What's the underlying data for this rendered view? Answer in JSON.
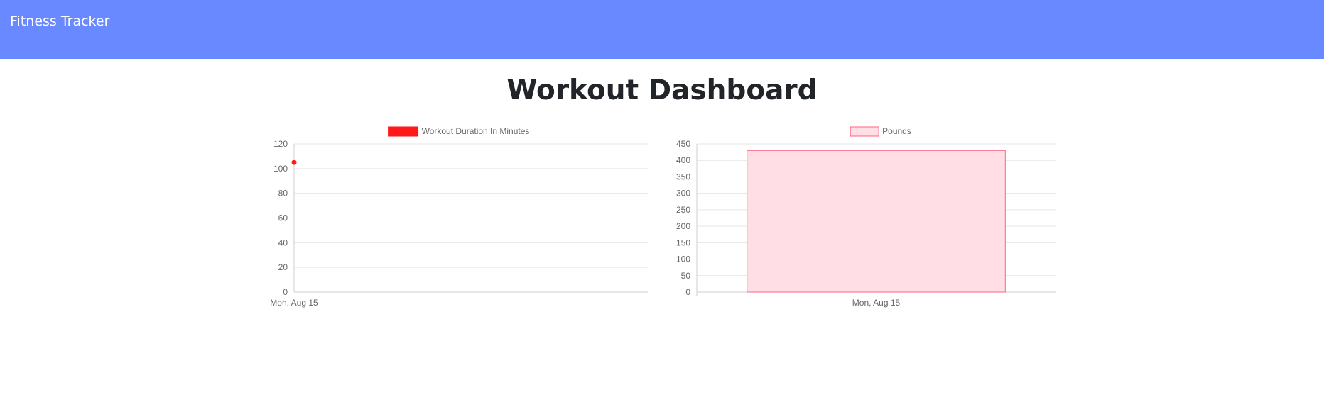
{
  "navbar": {
    "brand": "Fitness Tracker"
  },
  "page": {
    "title": "Workout Dashboard"
  },
  "chart_data": [
    {
      "type": "line",
      "legend": [
        "Workout Duration In Minutes"
      ],
      "legend_position": "top",
      "categories": [
        "Mon, Aug 15"
      ],
      "series": [
        {
          "name": "Workout Duration In Minutes",
          "values": [
            105
          ],
          "color": "#ff1a1a"
        }
      ],
      "ylim": [
        0,
        120
      ],
      "yticks": [
        0,
        20,
        40,
        60,
        80,
        100,
        120
      ],
      "grid": true
    },
    {
      "type": "bar",
      "legend": [
        "Pounds"
      ],
      "legend_position": "top",
      "categories": [
        "Mon, Aug 15"
      ],
      "series": [
        {
          "name": "Pounds",
          "values": [
            430
          ],
          "fill": "#ffdfe5",
          "stroke": "#ff6385"
        }
      ],
      "ylim": [
        0,
        450
      ],
      "yticks": [
        0,
        50,
        100,
        150,
        200,
        250,
        300,
        350,
        400,
        450
      ],
      "grid": true
    }
  ]
}
